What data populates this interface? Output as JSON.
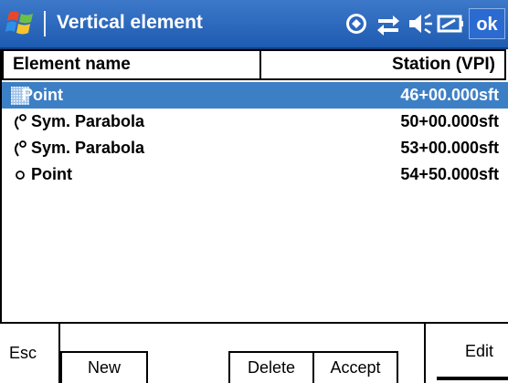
{
  "titlebar": {
    "title": "Vertical element",
    "ok_label": "ok",
    "tray_icons": [
      "sync-icon",
      "network-icon",
      "volume-icon",
      "battery-icon"
    ]
  },
  "grid": {
    "col_name": "Element name",
    "col_station": "Station (VPI)",
    "rows": [
      {
        "icon": "point-icon",
        "name": "Point",
        "station": "46+00.000sft",
        "selected": true
      },
      {
        "icon": "parabola-icon",
        "name": "Sym. Parabola",
        "station": "50+00.000sft",
        "selected": false
      },
      {
        "icon": "parabola-icon",
        "name": "Sym. Parabola",
        "station": "53+00.000sft",
        "selected": false
      },
      {
        "icon": "point-icon",
        "name": "Point",
        "station": "54+50.000sft",
        "selected": false
      }
    ]
  },
  "buttons": {
    "esc": "Esc",
    "new": "New",
    "delete": "Delete",
    "accept": "Accept",
    "edit": "Edit"
  },
  "colors": {
    "titlebar": "#1e5cb2",
    "selection": "#3d7fc5"
  }
}
